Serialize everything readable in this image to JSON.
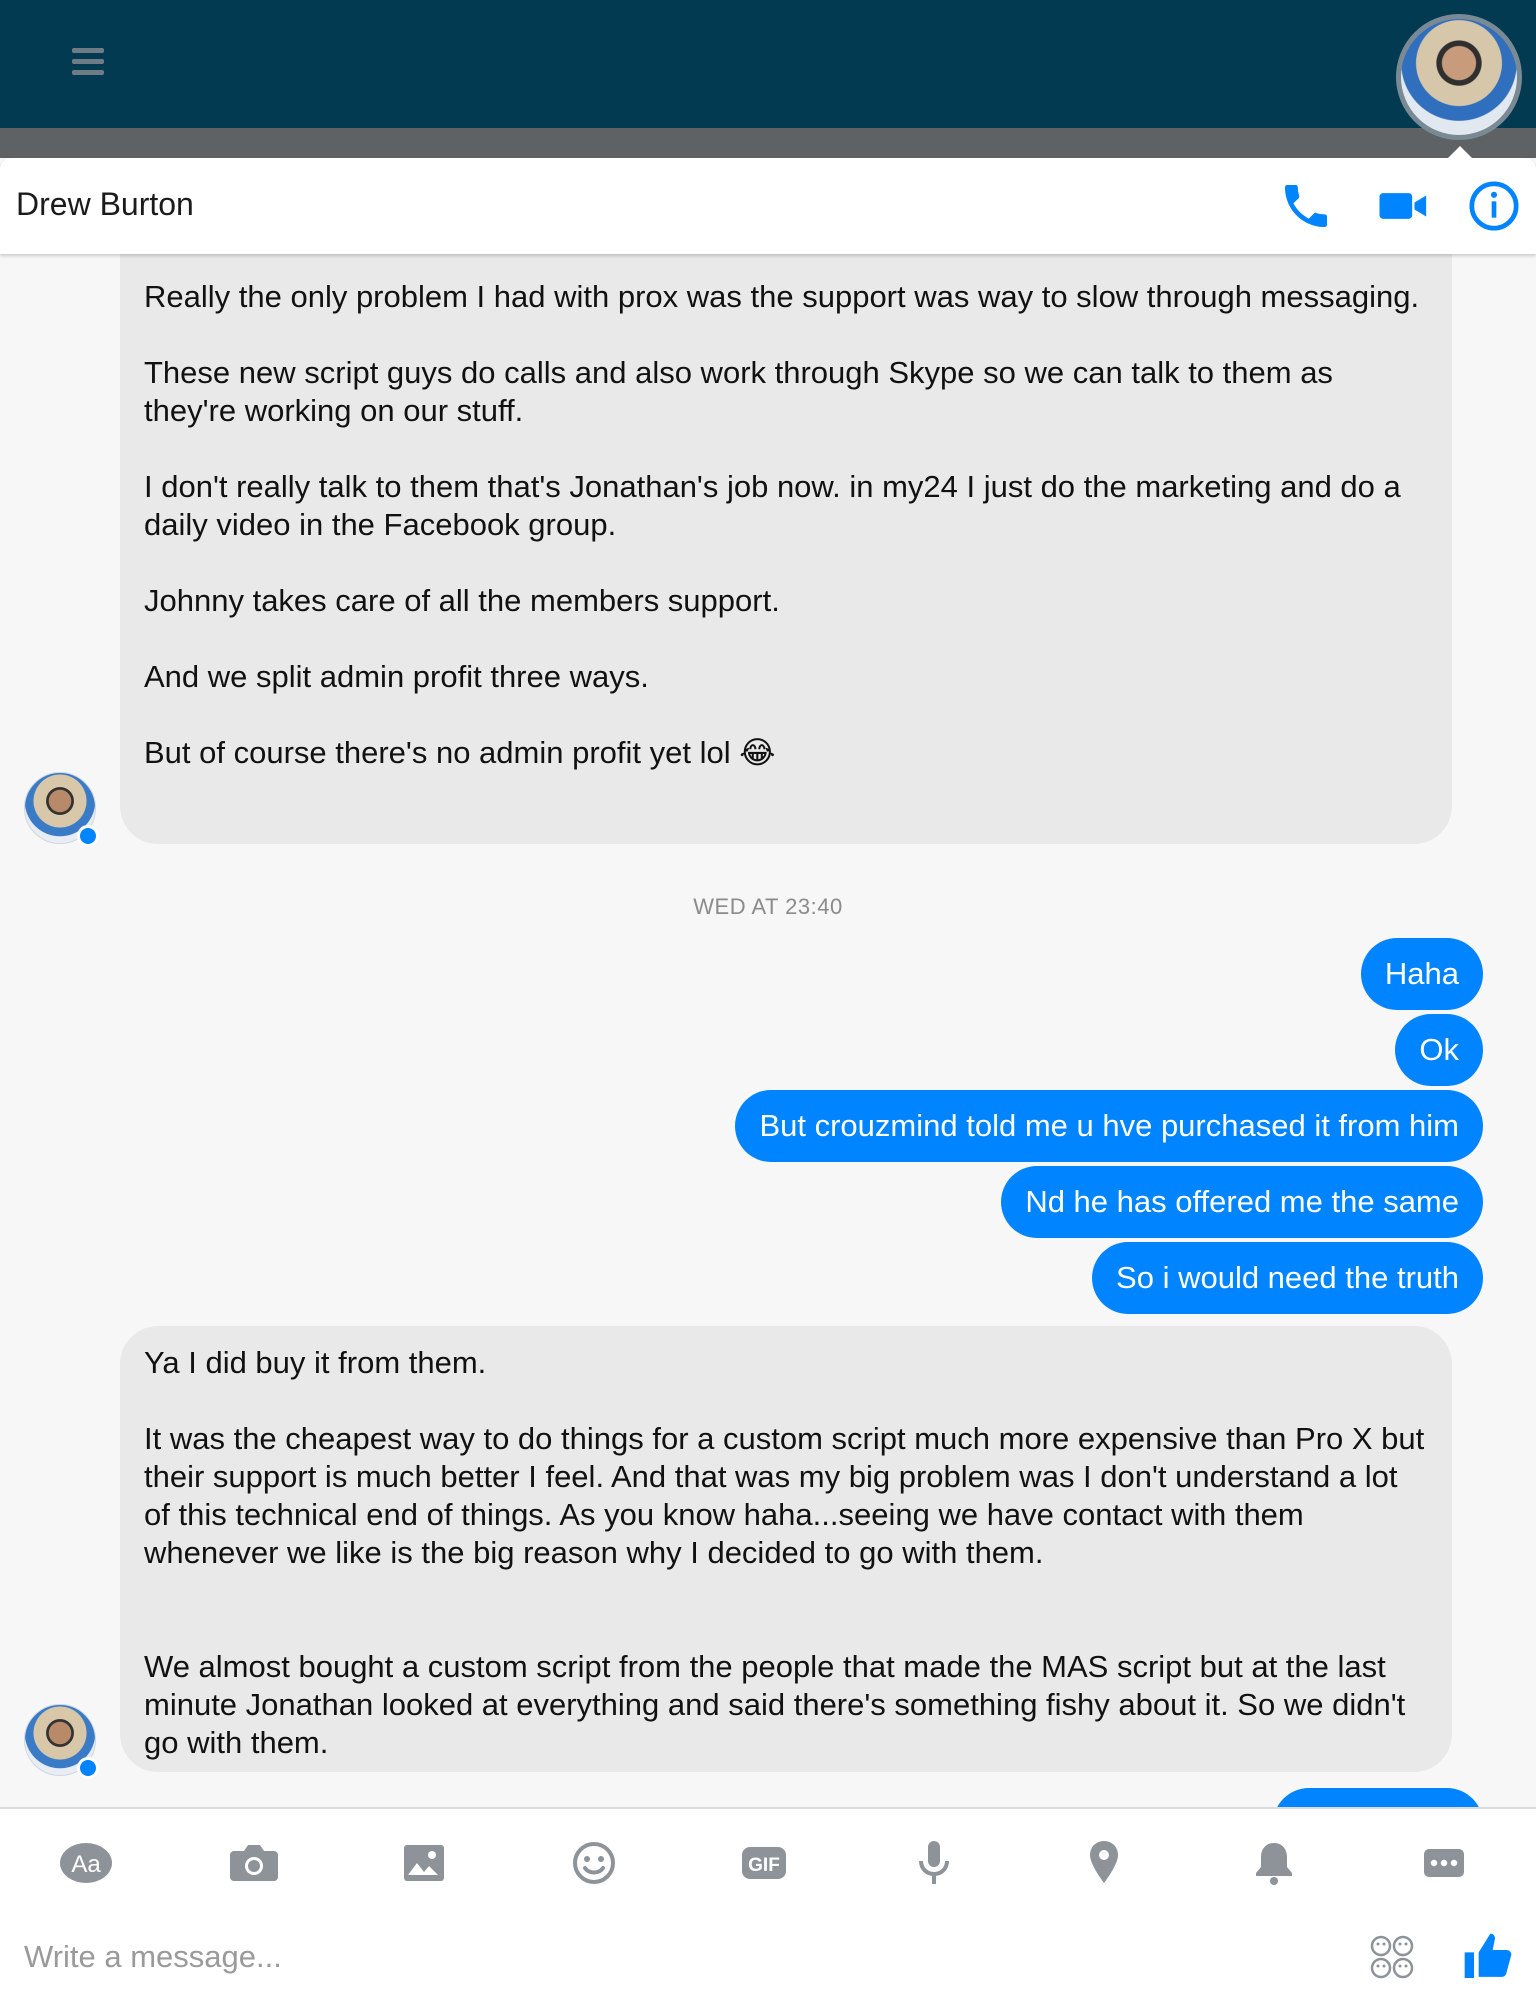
{
  "app": {
    "accent": "#0084ff",
    "topbar_color": "#013a51"
  },
  "header": {
    "contact_name": "Drew Burton",
    "icons": [
      "phone-icon",
      "video-camera-icon",
      "info-icon"
    ]
  },
  "messages": {
    "incoming_1": [
      "Really the only problem I had with prox was the support was way to slow through messaging.",
      "",
      "These new script guys do calls and also work through Skype so we can talk to them as they're working on our stuff.",
      "",
      "I don't really talk to them that's Jonathan's job now. in my24 I just do the marketing and do a daily video in the Facebook group.",
      "",
      "Johnny takes care of all the members support.",
      "",
      "And we split admin profit three ways.",
      "",
      "But of course there's no admin profit yet lol 😂"
    ],
    "timestamp": "WED AT 23:40",
    "outgoing": [
      "Haha",
      "Ok",
      "But crouzmind told me u hve purchased it from him",
      "Nd he has offered me the same",
      "So i would need the truth"
    ],
    "incoming_2": [
      "Ya I did buy it from them.",
      "",
      "It was the cheapest way to do things for a custom script much more expensive than Pro X but their support is much better I feel. And that was my big problem was I don't understand a lot of this technical end of things. As you know haha...seeing we have contact with them whenever we like is the big reason why I decided to go with them.",
      "",
      "",
      "We almost bought a custom script from the people that made the MAS script but at the last minute Jonathan looked at everything and said there's something fishy about it. So we didn't go with them."
    ]
  },
  "composer": {
    "placeholder": "Write a message...",
    "text_button_label": "Aa",
    "gif_label": "GIF",
    "toolbar_icons": [
      "text-format-icon",
      "camera-icon",
      "image-icon",
      "emoji-icon",
      "gif-icon",
      "microphone-icon",
      "location-pin-icon",
      "bell-icon",
      "more-icon"
    ],
    "sticker_icon": "sticker-icon",
    "send_icon": "like-icon"
  }
}
